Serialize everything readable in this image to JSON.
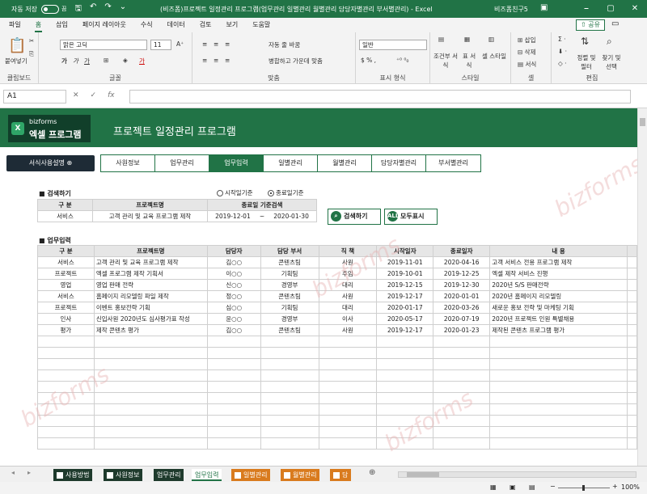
{
  "titlebar": {
    "autosave": "자동 저장",
    "toggle": "끔",
    "doc_title": "(비즈폼)프로젝트 일정관리 프로그램(업무관리 일별관리 월별관리 담당자별관리 부서별관리)  -  Excel",
    "user": "비즈폼친구5",
    "controls": [
      "⎯",
      "▢",
      "✕"
    ]
  },
  "menu": [
    "파일",
    "홈",
    "삽입",
    "페이지 레이아웃",
    "수식",
    "데이터",
    "검토",
    "보기",
    "도움말"
  ],
  "share": "공유",
  "ribbon": {
    "clipboard": {
      "paste": "붙여넣기",
      "label": "클립보드"
    },
    "font": {
      "name": "맑은 고딕",
      "size": "11",
      "label": "글꼴"
    },
    "align": {
      "wrap": "자동 줄 바꿈",
      "merge": "병합하고 가운데 맞춤",
      "label": "맞춤"
    },
    "number": {
      "format": "일반",
      "label": "표시 형식"
    },
    "styles": {
      "cond": "조건부 서식",
      "table": "표 서식",
      "cell": "셀 스타일",
      "label": "스타일"
    },
    "cells": {
      "insert": "삽입",
      "delete": "삭제",
      "format": "서식",
      "label": "셀"
    },
    "edit": {
      "sort": "정렬 및 필터",
      "find": "찾기 및 선택",
      "label": "편집"
    }
  },
  "formula_bar": {
    "name_box": "A1",
    "fx": "fx"
  },
  "app": {
    "logo_brand": "bizforms",
    "logo_title": "엑셀 프로그램",
    "title": "프로젝트 일정관리 프로그램",
    "guide": "서식사용설명 ⊕",
    "nav": [
      "사원정보",
      "업무관리",
      "업무입력",
      "일별관리",
      "월별관리",
      "담당자별관리",
      "부서별관리"
    ],
    "search_section": "검색하기",
    "radio_start": "시작일기준",
    "radio_end": "종료일기준",
    "search_headers": [
      "구 분",
      "프로젝트명",
      "종료일 기준검색"
    ],
    "search_row": {
      "category": "서비스",
      "project": "고객 관리 및 교육 프로그램 제작",
      "from": "2019-12-01",
      "sep": "~",
      "to": "2020-01-30"
    },
    "btn_search": "검색하기",
    "btn_all": "모두표시",
    "input_section": "업무입력",
    "headers": [
      "구 분",
      "프로젝트명",
      "담당자",
      "담당 부서",
      "직 책",
      "시작일자",
      "종료일자",
      "내 용"
    ],
    "rows": [
      [
        "서비스",
        "고객 관리 및 교육 프로그램 제작",
        "김○○",
        "콘텐츠팀",
        "사원",
        "2019-11-01",
        "2020-04-16",
        "고객 서비스 전용 프로그램 제작"
      ],
      [
        "프로젝트",
        "엑셀 프로그램 제작 기획서",
        "이○○",
        "기획팀",
        "주임",
        "2019-10-01",
        "2019-12-25",
        "엑셀 제작 서비스 진행"
      ],
      [
        "영업",
        "영업 판매 전략",
        "신○○",
        "경영부",
        "대리",
        "2019-12-15",
        "2019-12-30",
        "2020년 S/S 판매전략"
      ],
      [
        "서비스",
        "홈페이지 리모델링 파일 제작",
        "정○○",
        "콘텐츠팀",
        "사원",
        "2019-12-17",
        "2020-01-01",
        "2020년 홈페이지 리모델링"
      ],
      [
        "프로젝트",
        "이벤트 홍보전략 기획",
        "심○○",
        "기획팀",
        "대리",
        "2020-01-17",
        "2020-03-26",
        "새로운 홍보 전략 및 마케팅 기획"
      ],
      [
        "인사",
        "신입사원 2020년도 심사평가표 작성",
        "윤○○",
        "경영부",
        "이사",
        "2020-05-17",
        "2020-07-19",
        "2020년 프로젝트 인원 특별채용"
      ],
      [
        "평가",
        "제작 콘텐츠 평가",
        "김○○",
        "콘텐츠팀",
        "사원",
        "2019-12-17",
        "2020-01-23",
        "제작된 콘텐츠 프로그램 평가"
      ]
    ],
    "watermark": "bizforms"
  },
  "sheet_tabs": [
    "사용방법",
    "사원정보",
    "업무관리",
    "업무입력",
    "일별관리",
    "월별관리",
    "담"
  ],
  "status": {
    "zoom": "100%"
  },
  "colors": {
    "excel_green": "#217346",
    "tab_orange": "#d97b1e",
    "tab_dark": "#1e3a2c"
  }
}
